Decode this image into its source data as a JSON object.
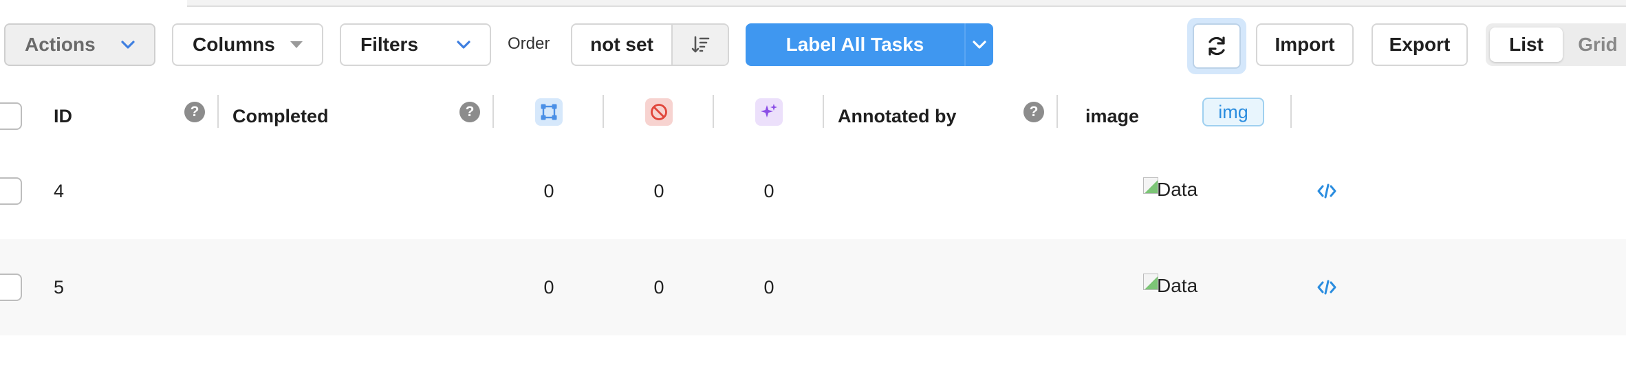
{
  "toolbar": {
    "actions_label": "Actions",
    "columns_label": "Columns",
    "filters_label": "Filters",
    "order_label": "Order",
    "order_value": "not set",
    "label_all_label": "Label All Tasks",
    "import_label": "Import",
    "export_label": "Export",
    "view_options": [
      "List",
      "Grid"
    ],
    "selected_view": "List",
    "accent_color": "#3f97f0"
  },
  "table": {
    "headers": {
      "id": "ID",
      "completed": "Completed",
      "annotated_by": "Annotated by",
      "image": "image",
      "image_type_tag": "img"
    },
    "header_icons": [
      "annotations-count-icon",
      "cancelled-count-icon",
      "predictions-count-icon"
    ],
    "help_mark": "?",
    "rows": [
      {
        "id": "4",
        "completed": "",
        "annotations": "0",
        "cancelled": "0",
        "predictions": "0",
        "annotated_by": "",
        "image_alt": "Data"
      },
      {
        "id": "5",
        "completed": "",
        "annotations": "0",
        "cancelled": "0",
        "predictions": "0",
        "annotated_by": "",
        "image_alt": "Data"
      }
    ]
  }
}
